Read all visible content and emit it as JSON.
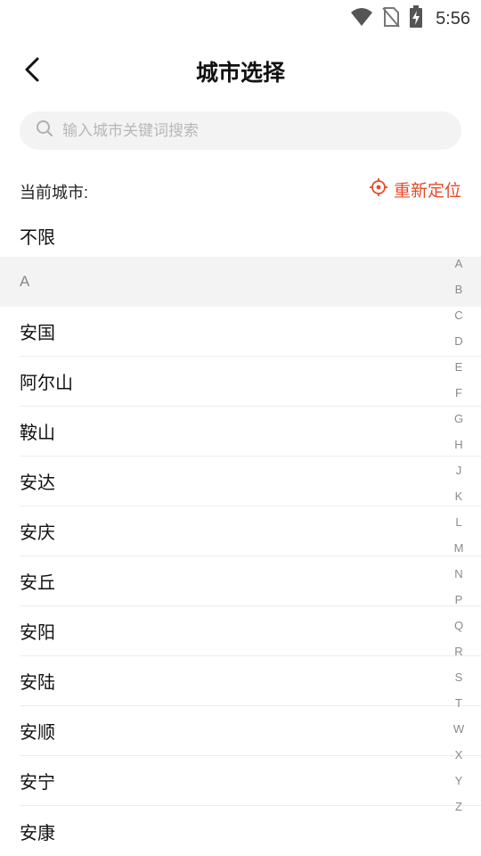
{
  "status": {
    "time": "5:56"
  },
  "header": {
    "title": "城市选择"
  },
  "search": {
    "placeholder": "输入城市关键词搜索",
    "value": ""
  },
  "current_city": {
    "label": "当前城市:",
    "relocate_label": "重新定位"
  },
  "unlimited_label": "不限",
  "section": {
    "letter": "A"
  },
  "cities": [
    {
      "name": "安国"
    },
    {
      "name": "阿尔山"
    },
    {
      "name": "鞍山"
    },
    {
      "name": "安达"
    },
    {
      "name": "安庆"
    },
    {
      "name": "安丘"
    },
    {
      "name": "安阳"
    },
    {
      "name": "安陆"
    },
    {
      "name": "安顺"
    },
    {
      "name": "安宁"
    },
    {
      "name": "安康"
    }
  ],
  "index_letters": [
    "A",
    "B",
    "C",
    "D",
    "E",
    "F",
    "G",
    "H",
    "J",
    "K",
    "L",
    "M",
    "N",
    "P",
    "Q",
    "R",
    "S",
    "T",
    "W",
    "X",
    "Y",
    "Z"
  ],
  "colors": {
    "accent": "#e8492a",
    "search_bg": "#f3f3f3",
    "section_bg": "#f3f3f3"
  },
  "icons": {
    "back": "chevron-left-icon",
    "search": "search-icon",
    "relocate": "crosshair-icon",
    "wifi": "wifi-icon",
    "no_sim": "no-sim-icon",
    "battery": "battery-charging-icon"
  }
}
